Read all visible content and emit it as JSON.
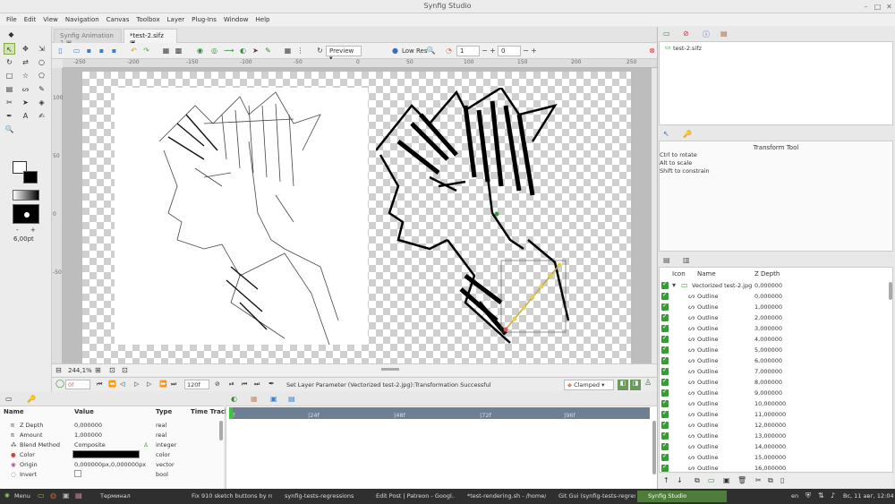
{
  "window": {
    "title": "Synfig Studio"
  },
  "menu": [
    "File",
    "Edit",
    "View",
    "Navigation",
    "Canvas",
    "Toolbox",
    "Layer",
    "Plug-Ins",
    "Window",
    "Help"
  ],
  "tabs": [
    {
      "label": "Synfig Animation 1"
    },
    {
      "label": "*test-2.sifz"
    }
  ],
  "toolbar": {
    "preview_label": "Preview",
    "quality_label": "Low Res",
    "frame_a": "1",
    "frame_b": "0"
  },
  "ruler": {
    "h": [
      "-250",
      "-200",
      "-150",
      "-100",
      "-50",
      "0",
      "50",
      "100",
      "150",
      "200",
      "250"
    ],
    "v": [
      "100",
      "50",
      "0",
      "-50"
    ]
  },
  "toolbox": {
    "brush_size": "6,00pt"
  },
  "status": {
    "zoom": "244,1%",
    "current_frame": "0f",
    "end_frame": "120f",
    "message": "Set Layer Parameter (Vectorized test-2.jpg):Transformation Successful",
    "interpolation": "Clamped"
  },
  "params": {
    "headers": [
      "Name",
      "Value",
      "Type",
      "Time Track"
    ],
    "rows": [
      {
        "name": "Z Depth",
        "value": "0,000000",
        "type": "real"
      },
      {
        "name": "Amount",
        "value": "1,000000",
        "type": "real"
      },
      {
        "name": "Blend Method",
        "value": "Composite",
        "type": "integer"
      },
      {
        "name": "Color",
        "value": "",
        "type": "color"
      },
      {
        "name": "Origin",
        "value": "0,000000px,0,000000px",
        "type": "vector"
      },
      {
        "name": "Invert",
        "value": "",
        "type": "bool"
      }
    ]
  },
  "timeline": {
    "ticks": [
      "0f",
      "|24f",
      "|48f",
      "|72f",
      "|96f"
    ]
  },
  "canvas_browser": {
    "file": "test-2.sifz"
  },
  "tool_options": {
    "title": "Transform Tool",
    "lines": [
      "Ctrl to rotate",
      "Alt to scale",
      "Shift to constrain"
    ]
  },
  "layers": {
    "headers": [
      "Icon",
      "Name",
      "Z Depth"
    ],
    "rows": [
      {
        "name": "Vectorized test-2.jpg",
        "z": "0,000000",
        "group": true
      },
      {
        "name": "Outline",
        "z": "0,000000"
      },
      {
        "name": "Outline",
        "z": "1,000000"
      },
      {
        "name": "Outline",
        "z": "2,000000"
      },
      {
        "name": "Outline",
        "z": "3,000000"
      },
      {
        "name": "Outline",
        "z": "4,000000"
      },
      {
        "name": "Outline",
        "z": "5,000000"
      },
      {
        "name": "Outline",
        "z": "6,000000"
      },
      {
        "name": "Outline",
        "z": "7,000000"
      },
      {
        "name": "Outline",
        "z": "8,000000"
      },
      {
        "name": "Outline",
        "z": "9,000000"
      },
      {
        "name": "Outline",
        "z": "10,000000"
      },
      {
        "name": "Outline",
        "z": "11,000000"
      },
      {
        "name": "Outline",
        "z": "12,000000"
      },
      {
        "name": "Outline",
        "z": "13,000000"
      },
      {
        "name": "Outline",
        "z": "14,000000"
      },
      {
        "name": "Outline",
        "z": "15,000000"
      },
      {
        "name": "Outline",
        "z": "16,000000"
      }
    ]
  },
  "taskbar": {
    "menu": "Menu",
    "tasks": [
      "Терминал",
      "Fix 910 sketch buttons by ro...",
      "synfig-tests-regressions",
      "Edit Post | Patreon - Googl...",
      "*test-rendering.sh - /home/...",
      "Git Gui (synfig-tests-regres...",
      "Synfig Studio"
    ],
    "lang": "en",
    "clock": "Вс, 11 авг, 12:04"
  }
}
